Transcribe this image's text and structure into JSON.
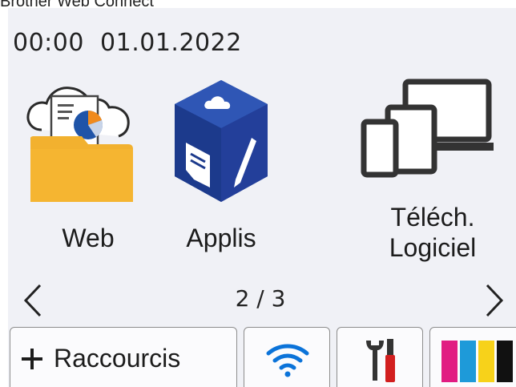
{
  "window": {
    "caption": "Brother Web Connect"
  },
  "status": {
    "time": "00:00",
    "date": "01.01.2022"
  },
  "apps": [
    {
      "label": "Web",
      "icon": "cloud-folder-icon"
    },
    {
      "label": "Applis",
      "icon": "apps-cube-icon"
    },
    {
      "label_line1": "Téléch.",
      "label_line2": "Logiciel",
      "icon": "devices-icon"
    }
  ],
  "pager": {
    "text": "2 / 3",
    "prev_icon": "chevron-left-icon",
    "next_icon": "chevron-right-icon"
  },
  "bottom_bar": {
    "shortcuts_label": "Raccourcis",
    "shortcuts_icon": "plus-icon",
    "wifi_icon": "wifi-icon",
    "settings_icon": "tools-icon",
    "ink_icon": "ink-levels-icon"
  },
  "colors": {
    "panel_bg": "#f0f1f6",
    "folder": "#f2b12f",
    "cube": "#1f3f97",
    "wifi": "#0b73d9",
    "ink_magenta": "#e11c82",
    "ink_cyan": "#1e9ad9",
    "ink_yellow": "#f7d21a",
    "ink_black": "#111111"
  }
}
